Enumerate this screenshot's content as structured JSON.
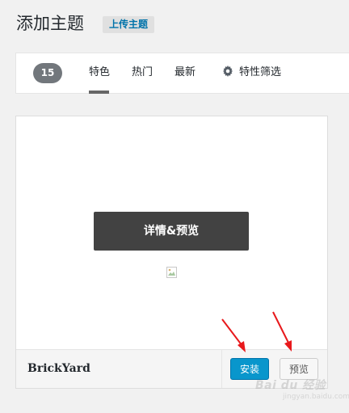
{
  "header": {
    "title": "添加主题",
    "upload_label": "上传主题"
  },
  "filter": {
    "count": "15",
    "tabs": [
      {
        "label": "特色",
        "active": true
      },
      {
        "label": "热门",
        "active": false
      },
      {
        "label": "最新",
        "active": false
      },
      {
        "label": "特性筛选",
        "icon": "gear-icon",
        "active": false
      }
    ]
  },
  "theme": {
    "name": "BrickYard",
    "details_label": "详情&预览",
    "install_label": "安装",
    "preview_label": "预览"
  },
  "watermark": {
    "text": "Bai du 经验",
    "subtext": "jingyan.baidu.com"
  },
  "colors": {
    "accent": "#0073aa",
    "install_button": "#0996cc",
    "annotation_arrow": "#e8191c",
    "badge": "#72777c"
  }
}
